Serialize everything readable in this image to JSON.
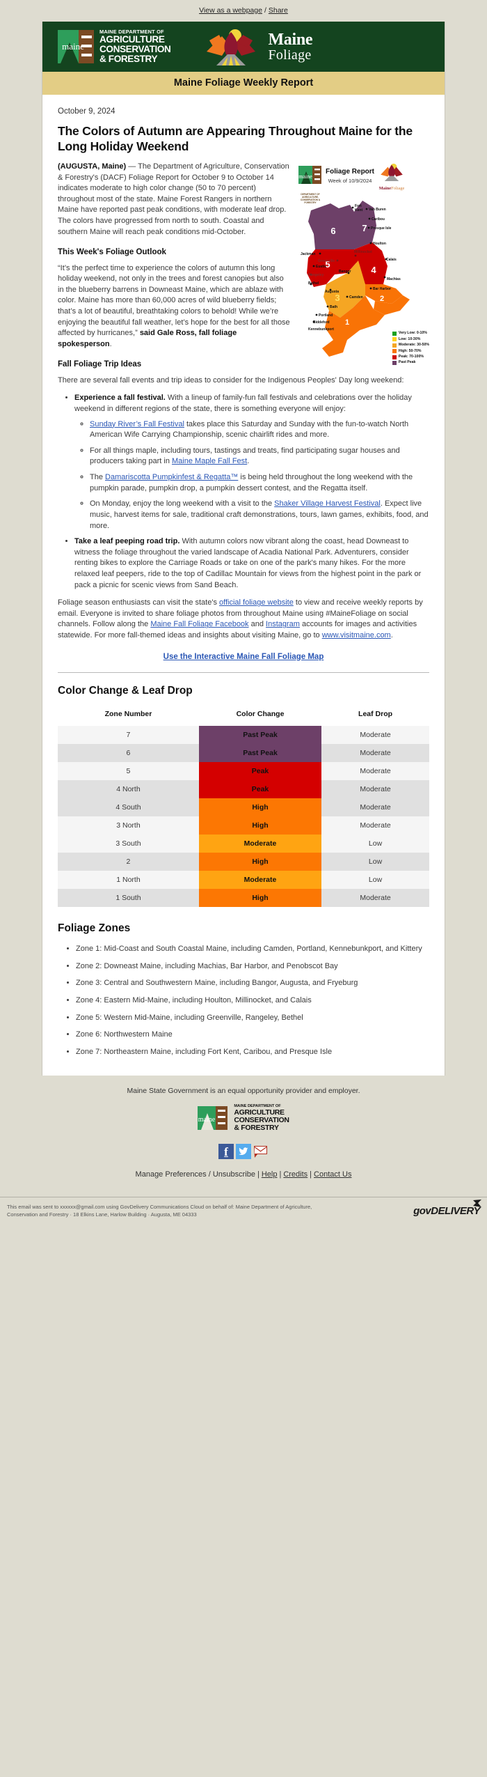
{
  "preheader": {
    "view": "View as a webpage",
    "sep": "/",
    "share": "Share"
  },
  "masthead": {
    "dept_line1": "MAINE DEPARTMENT OF",
    "dept_line2": "AGRICULTURE",
    "dept_line3": "CONSERVATION",
    "dept_line4": "& FORESTRY",
    "logo_word": "maine",
    "foliage_line1": "Maine",
    "foliage_line2": "Foliage"
  },
  "titlebar": {
    "text": "Maine Foliage Weekly Report"
  },
  "article": {
    "date": "October 9, 2024",
    "headline": "The Colors of Autumn are Appearing Throughout Maine for the Long Holiday Weekend",
    "dateline": "(AUGUSTA, Maine)",
    "lead": " — The Department of Agriculture, Conservation & Forestry's (DACF) Foliage Report for October 9 to October 14 indicates moderate to high color change (50 to 70 percent) throughout most of the state. Maine Forest Rangers in northern Maine have reported past peak conditions, with moderate leaf drop. The colors have progressed from north to south. Coastal and southern Maine will reach peak conditions mid-October.",
    "outlook_heading": "This Week's Foliage Outlook",
    "quote": "“It’s the perfect time to experience the colors of autumn this long holiday weekend, not only in the trees and forest canopies but also in the blueberry barrens in Downeast Maine, which are ablaze with color. Maine has more than 60,000 acres of wild blueberry fields; that’s a lot of beautiful, breathtaking colors to behold! While we’re enjoying the beautiful fall weather, let’s hope for the best for all those affected by hurricanes,” ",
    "quote_attrib": "said Gale Ross, fall foliage spokesperson",
    "quote_end": ".",
    "trip_heading": "Fall Foliage Trip Ideas",
    "trip_intro": "There are several fall events and trip ideas to consider for the Indigenous Peoples' Day long weekend:"
  },
  "map": {
    "title": "Foliage Report",
    "subtitle": "Week of 10/9/2024",
    "mini_dept": "DEPARTMENT OF AGRICULTURE, CONSERVATION & FORESTRY",
    "brand_a": "Maine",
    "brand_b": "Foliage",
    "zone_labels": [
      "6",
      "7",
      "5",
      "4",
      "3",
      "2",
      "1"
    ],
    "cities": [
      "Fort Kent",
      "Van Buren",
      "Caribou",
      "Presque Isle",
      "Houlton",
      "Millinocket",
      "Calais",
      "Machias",
      "Bar Harbor",
      "Jackman",
      "Greenville",
      "Eustis",
      "Rangeley",
      "Bethel",
      "Bangor",
      "Augusta",
      "Camden",
      "Bath",
      "Portland",
      "Biddeford",
      "Kennebunkport"
    ],
    "legend": [
      {
        "label": "Very Low: 0-10%",
        "color": "#17a01e"
      },
      {
        "label": "Low: 10-30%",
        "color": "#ffd21e"
      },
      {
        "label": "Moderate: 30-50%",
        "color": "#f5a623"
      },
      {
        "label": "High: 50-70%",
        "color": "#f97306"
      },
      {
        "label": "Peak: 70-100%",
        "color": "#cc0000"
      },
      {
        "label": "Past Peak",
        "color": "#6d4068"
      }
    ]
  },
  "bullets": [
    {
      "lead": "Experience a fall festival.",
      "rest": " With a lineup of family-fun fall festivals and celebrations over the holiday weekend in different regions of the state, there is something everyone will enjoy:",
      "sub": [
        {
          "pre": "",
          "link": "Sunday River’s Fall Festival",
          "post": " takes place this Saturday and Sunday with the fun-to-watch North American Wife Carrying Championship, scenic chairlift rides and more."
        },
        {
          "pre": "For all things maple, including tours, tastings and treats, find participating sugar houses and producers taking part in ",
          "link": "Maine Maple Fall Fest",
          "post": "."
        },
        {
          "pre": "The ",
          "link": "Damariscotta Pumpkinfest & Regatta™",
          "post": " is being held throughout the long weekend with the pumpkin parade, pumpkin drop, a pumpkin dessert contest, and the Regatta itself."
        },
        {
          "pre": "On Monday, enjoy the long weekend with a visit to the ",
          "link": "Shaker Village Harvest Festival",
          "post": ". Expect live music, harvest items for sale, traditional craft demonstrations, tours, lawn games, exhibits, food, and more."
        }
      ]
    },
    {
      "lead": "Take a leaf peeping road trip.",
      "rest": " With autumn colors now vibrant along the coast, head Downeast to witness the foliage throughout the varied landscape of Acadia National Park. Adventurers, consider renting bikes to explore the Carriage Roads or take on one of the park's many hikes. For the more relaxed leaf peepers, ride to the top of Cadillac Mountain for views from the highest point in the park or pack a picnic for scenic views from Sand Beach.",
      "sub": []
    }
  ],
  "closing": {
    "p1_a": "Foliage season enthusiasts can visit the state's ",
    "p1_link1": "official foliage website",
    "p1_b": " to view and receive weekly reports by email. Everyone is invited to share foliage photos from throughout Maine using #MaineFoliage on social channels. Follow along the ",
    "p1_link2": "Maine Fall Foliage Facebook",
    "p1_c": " and ",
    "p1_link3": "Instagram",
    "p1_d": " accounts for images and activities statewide. For more fall-themed ideas and insights about visiting Maine, go to ",
    "p1_link4": "www.visitmaine.com",
    "p1_e": ".",
    "cta": "Use the Interactive Maine Fall Foliage Map"
  },
  "table": {
    "title": "Color Change & Leaf Drop",
    "headers": [
      "Zone Number",
      "Color Change",
      "Leaf Drop"
    ],
    "colors": {
      "Past Peak": "#6d4068",
      "Peak": "#d40000",
      "High": "#fc7703",
      "Moderate": "#ffa412"
    },
    "rows": [
      {
        "zone": "7",
        "color_change": "Past Peak",
        "leaf_drop": "Moderate"
      },
      {
        "zone": "6",
        "color_change": "Past Peak",
        "leaf_drop": "Moderate"
      },
      {
        "zone": "5",
        "color_change": "Peak",
        "leaf_drop": "Moderate"
      },
      {
        "zone": "4 North",
        "color_change": "Peak",
        "leaf_drop": "Moderate"
      },
      {
        "zone": "4 South",
        "color_change": "High",
        "leaf_drop": "Moderate"
      },
      {
        "zone": "3 North",
        "color_change": "High",
        "leaf_drop": "Moderate"
      },
      {
        "zone": "3 South",
        "color_change": "Moderate",
        "leaf_drop": "Low"
      },
      {
        "zone": "2",
        "color_change": "High",
        "leaf_drop": "Low"
      },
      {
        "zone": "1 North",
        "color_change": "Moderate",
        "leaf_drop": "Low"
      },
      {
        "zone": "1 South",
        "color_change": "High",
        "leaf_drop": "Moderate"
      }
    ]
  },
  "zones": {
    "title": "Foliage Zones",
    "items": [
      "Zone 1: Mid-Coast and South Coastal Maine, including Camden, Portland, Kennebunkport, and Kittery",
      "Zone 2: Downeast Maine, including Machias, Bar Harbor, and Penobscot Bay",
      "Zone 3: Central and Southwestern Maine, including Bangor, Augusta, and Fryeburg",
      "Zone 4: Eastern Mid-Maine, including Houlton, Millinocket, and Calais",
      "Zone 5: Western Mid-Maine, including Greenville, Rangeley, Bethel",
      "Zone 6: Northwestern Maine",
      "Zone 7: Northeastern Maine, including Fort Kent, Caribou, and Presque Isle"
    ]
  },
  "footer": {
    "eeo": "Maine State Government is an equal opportunity provider and employer.",
    "prefs_plain": "Manage Preferences / Unsubscribe",
    "bar": "|",
    "help": "Help",
    "credits": "Credits",
    "contact": "Contact Us",
    "legal_line1": "This email was sent to xxxxxx@gmail.com using GovDelivery Communications Cloud on behalf of: Maine Department of Agriculture,",
    "legal_line2": "Conservation and Forestry · 18 Elkins Lane, Harlow Building · Augusta, ME 04333",
    "govdelivery": "govDELIVERY"
  }
}
